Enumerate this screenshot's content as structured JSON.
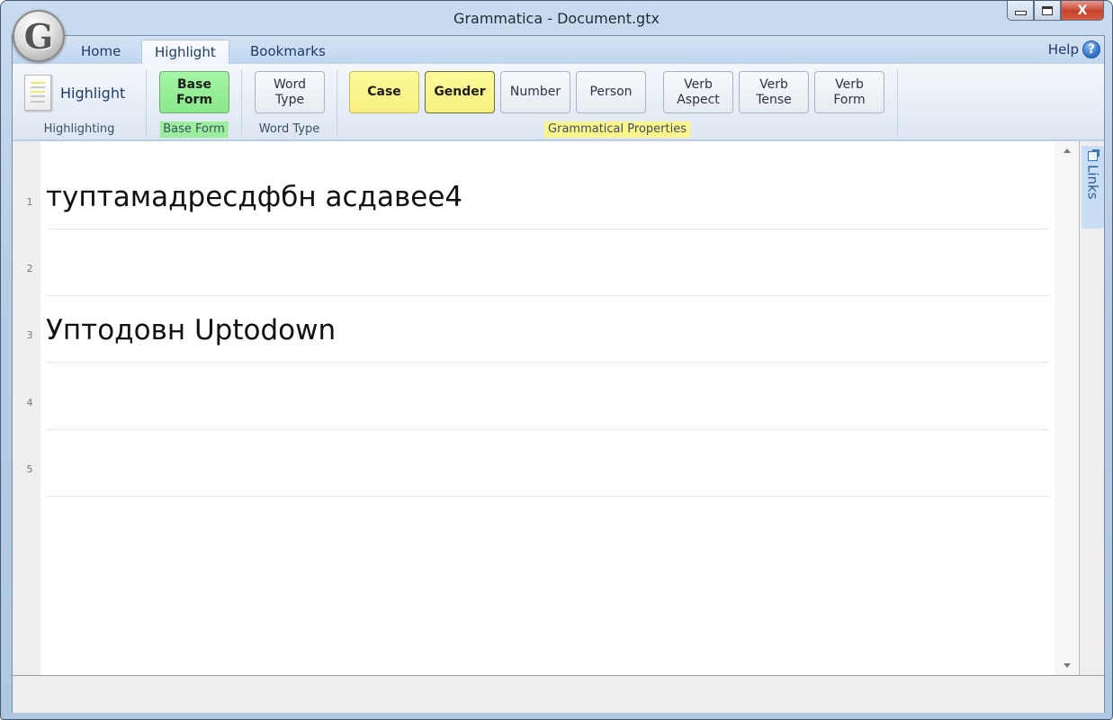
{
  "window": {
    "title": "Grammatica - Document.gtx",
    "controls": {
      "minimize": "minimize",
      "maximize": "maximize",
      "close": "X"
    },
    "app_orb_letter": "G"
  },
  "tabs": [
    {
      "label": "Home",
      "active": false
    },
    {
      "label": "Highlight",
      "active": true
    },
    {
      "label": "Bookmarks",
      "active": false
    }
  ],
  "help": {
    "label": "Help",
    "icon_glyph": "?"
  },
  "ribbon": {
    "groups": {
      "highlighting": {
        "label": "Highlighting",
        "button": "Highlight"
      },
      "base_form": {
        "label": "Base Form",
        "button_line1": "Base",
        "button_line2": "Form",
        "color": "#9bee9b"
      },
      "word_type": {
        "label": "Word Type",
        "button_line1": "Word",
        "button_line2": "Type"
      },
      "grammatical_properties": {
        "label": "Grammatical Properties",
        "color": "#fbf58a",
        "buttons": [
          {
            "line1": "Case",
            "line2": "",
            "active": true
          },
          {
            "line1": "Gender",
            "line2": "",
            "active": true
          },
          {
            "line1": "Number",
            "line2": "",
            "active": false
          },
          {
            "line1": "Person",
            "line2": "",
            "active": false
          },
          {
            "line1": "Verb",
            "line2": "Aspect",
            "active": false
          },
          {
            "line1": "Verb",
            "line2": "Tense",
            "active": false
          },
          {
            "line1": "Verb",
            "line2": "Form",
            "active": false
          }
        ]
      }
    }
  },
  "document": {
    "lines": [
      {
        "number": "1",
        "text": "туптамадресдфбн асдавее4"
      },
      {
        "number": "2",
        "text": ""
      },
      {
        "number": "3",
        "text": "Уптодовн Uptodown"
      },
      {
        "number": "4",
        "text": ""
      },
      {
        "number": "5",
        "text": ""
      }
    ]
  },
  "side_panel": {
    "links_label": "Links"
  }
}
